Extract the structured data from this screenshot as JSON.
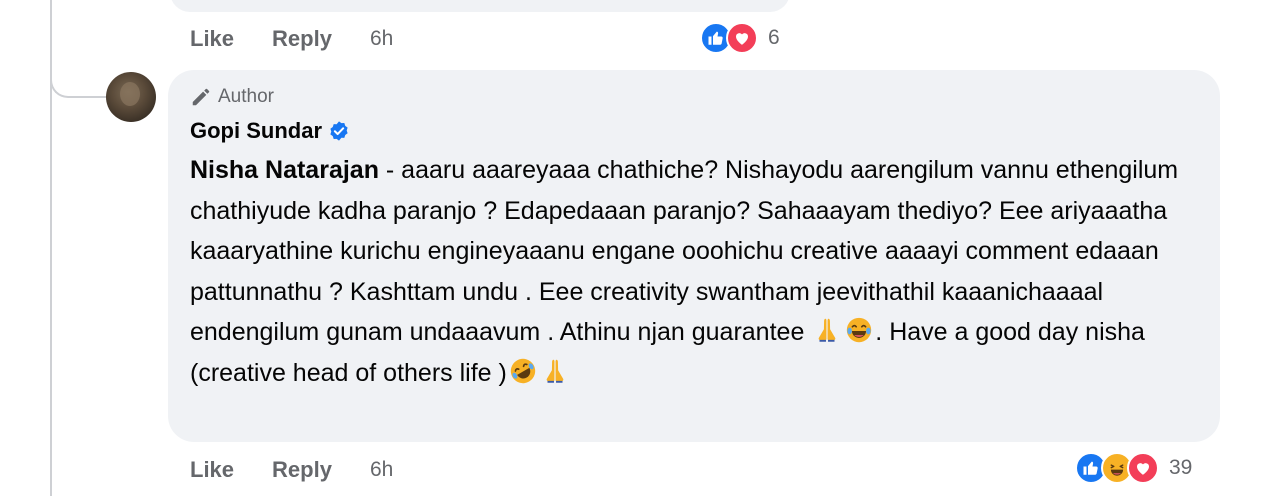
{
  "previous_comment": {
    "actions": {
      "like": "Like",
      "reply": "Reply",
      "time": "6h"
    },
    "reactions": {
      "icons": [
        "like-icon",
        "love-icon"
      ],
      "count": "6"
    }
  },
  "comment": {
    "badge": "Author",
    "author": "Gopi Sundar",
    "verified": true,
    "mention": "Nisha Natarajan",
    "text_part1": " - aaaru aaareyaaa chathiche? Nishayodu aarengilum vannu ethengilum chathiyude kadha paranjo ? Edapedaaan paranjo? Sahaaayam thediyo? Eee ariyaaatha kaaaryathine kurichu engineyaaanu engane ooohichu creative aaaayi comment edaaan pattunnathu ? Kashttam undu . Eee creativity swantham jeevithathil kaaanichaaaal endengilum gunam undaaavum . Athinu njan guarantee ",
    "text_part2": ". Have a good day nisha (creative head of others life )",
    "emojis_inline": [
      "folded-hands",
      "laughing-tears"
    ],
    "emojis_end": [
      "rolling-laughing",
      "folded-hands"
    ],
    "actions": {
      "like": "Like",
      "reply": "Reply",
      "time": "6h"
    },
    "reactions": {
      "icons": [
        "like-icon",
        "haha-icon",
        "love-icon"
      ],
      "count": "39"
    }
  },
  "colors": {
    "bubble": "#f0f2f5",
    "like_blue": "#1877f2",
    "love_red": "#f33e58",
    "haha_yellow": "#f7b125",
    "muted": "#65676b"
  }
}
